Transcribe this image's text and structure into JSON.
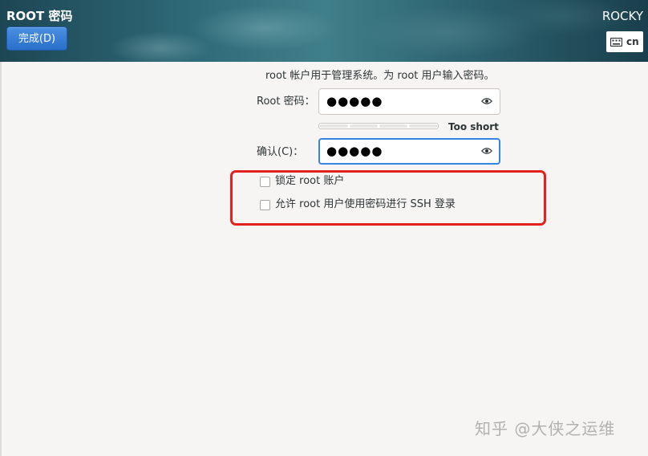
{
  "header": {
    "title": "ROOT 密码",
    "done_button": "完成(D)",
    "distro": "ROCKY",
    "keyboard_layout": "cn"
  },
  "form": {
    "intro": "root 帐户用于管理系统。为 root 用户输入密码。",
    "password_label": "Root 密码：",
    "password_value": "●●●●●",
    "strength_text": "Too short",
    "confirm_label": "确认(C)：",
    "confirm_value": "●●●●●",
    "lock_root_label": "锁定 root 账户",
    "allow_ssh_label": "允许 root 用户使用密码进行 SSH 登录"
  },
  "watermark": "知乎 @大侠之运维",
  "colors": {
    "accent": "#3584e4",
    "highlight": "#e1221f"
  }
}
